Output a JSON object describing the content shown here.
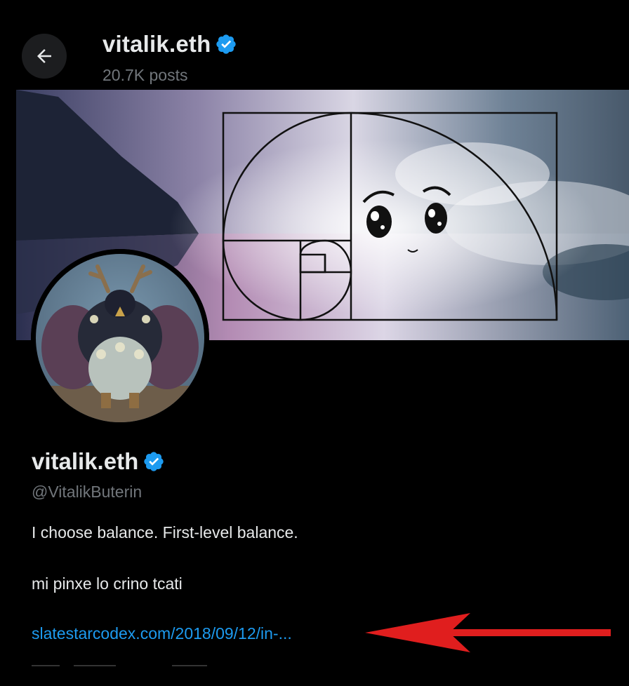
{
  "header": {
    "name": "vitalik.eth",
    "posts": "20.7K posts",
    "back_icon": "arrow-left-icon",
    "verified_icon": "verified-badge-icon"
  },
  "profile": {
    "name": "vitalik.eth",
    "handle": "@VitalikButerin",
    "bio_lines": [
      "I choose balance. First-level balance.",
      "mi pinxe lo crino tcati"
    ],
    "link": "slatestarcodex.com/2018/09/12/in-..."
  },
  "colors": {
    "background": "#000000",
    "text_primary": "#e7e9ea",
    "text_secondary": "#71767b",
    "link": "#1d9bf0",
    "verified": "#1d9bf0",
    "annotation_arrow": "#e01e1e"
  }
}
